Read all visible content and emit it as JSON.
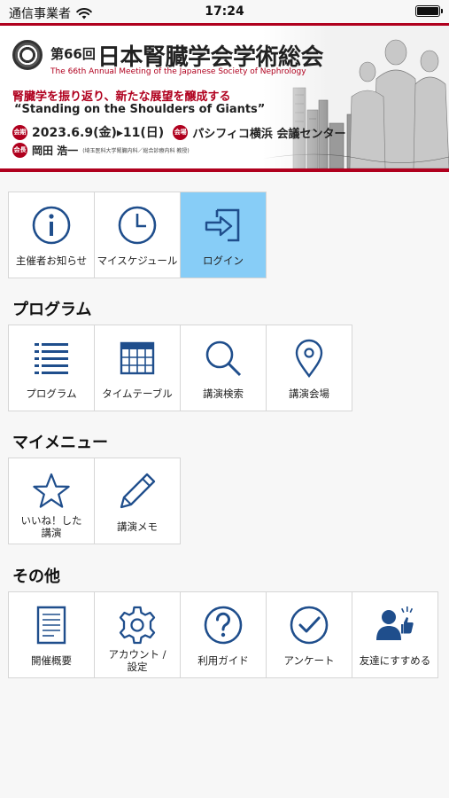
{
  "status_bar": {
    "carrier": "通信事業者",
    "time": "17:24"
  },
  "banner": {
    "edition": "第66回",
    "title_jp": "日本腎臓学会学術総会",
    "title_en": "The 66th Annual Meeting of the Japanese Society of Nephrology",
    "theme_jp": "腎臓学を振り返り、新たな展望を醸成する",
    "theme_en": "“Standing on the Shoulders of Giants”",
    "date_tag": "会期",
    "dates": "2023.6.9(金)▸11(日)",
    "venue_tag": "会場",
    "venue": "パシフィコ横浜 会議センター",
    "chair_tag": "会長",
    "chair": "岡田 浩一",
    "chair_affiliation": "(埼玉医科大学腎臓内科／総合診療内科 教授)"
  },
  "top_menu": [
    {
      "label": "主催者お知らせ",
      "icon": "info-icon",
      "active": false
    },
    {
      "label": "マイスケジュール",
      "icon": "clock-icon",
      "active": false
    },
    {
      "label": "ログイン",
      "icon": "login-icon",
      "active": true
    }
  ],
  "sections": {
    "program": {
      "title": "プログラム",
      "items": [
        {
          "label": "プログラム",
          "icon": "list-icon"
        },
        {
          "label": "タイムテーブル",
          "icon": "calendar-icon"
        },
        {
          "label": "講演検索",
          "icon": "search-icon"
        },
        {
          "label": "講演会場",
          "icon": "map-pin-icon"
        }
      ]
    },
    "my_menu": {
      "title": "マイメニュー",
      "items": [
        {
          "label_line1": "いいね！した",
          "label_line2": "講演",
          "icon": "star-icon"
        },
        {
          "label": "講演メモ",
          "icon": "pencil-icon"
        }
      ]
    },
    "other": {
      "title": "その他",
      "items": [
        {
          "label": "開催概要",
          "icon": "document-icon"
        },
        {
          "label_line1": "アカウント /",
          "label_line2": "設定",
          "icon": "gear-icon"
        },
        {
          "label": "利用ガイド",
          "icon": "help-icon"
        },
        {
          "label": "アンケート",
          "icon": "check-circle-icon"
        },
        {
          "label": "友達にすすめる",
          "icon": "recommend-icon"
        }
      ]
    }
  },
  "colors": {
    "icon_blue": "#1f4e8c",
    "accent_red": "#b0001e",
    "active_tile": "#87cdf7"
  }
}
